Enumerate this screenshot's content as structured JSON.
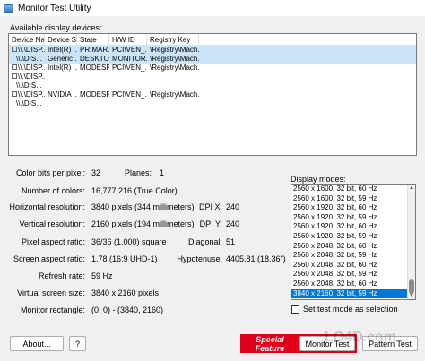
{
  "window": {
    "title": "Monitor Test Utility"
  },
  "devices": {
    "label": "Available display devices:",
    "columns": [
      "Device Na...",
      "Device S...",
      "State",
      "H/W ID",
      "Registry Key"
    ],
    "rows": [
      {
        "cells": [
          "\\\\.\\DISP...",
          "Intel(R) ...",
          "PRIMAR...",
          "PCI\\VEN_...",
          "\\Registry\\Mach..."
        ],
        "selected": true,
        "expander": true,
        "indent": false
      },
      {
        "cells": [
          "\\\\.\\DIS...",
          "Generic ...",
          "DESKTO...",
          "MONITOR...",
          "\\Registry\\Mach..."
        ],
        "selected": true,
        "expander": false,
        "indent": true
      },
      {
        "cells": [
          "\\\\.\\DISP...",
          "Intel(R) ...",
          "MODESP...",
          "PCI\\VEN_...",
          "\\Registry\\Mach..."
        ],
        "selected": false,
        "expander": true,
        "indent": false
      },
      {
        "cells": [
          "\\\\.\\DISP...",
          "",
          "",
          "",
          ""
        ],
        "selected": false,
        "expander": true,
        "indent": false
      },
      {
        "cells": [
          "\\\\.\\DIS...",
          "",
          "",
          "",
          ""
        ],
        "selected": false,
        "expander": false,
        "indent": true
      },
      {
        "cells": [
          "\\\\.\\DISP...",
          "NVIDIA ...",
          "MODESP...",
          "PCI\\VEN_...",
          "\\Registry\\Mach..."
        ],
        "selected": false,
        "expander": true,
        "indent": false
      },
      {
        "cells": [
          "\\\\.\\DIS...",
          "",
          "",
          "",
          ""
        ],
        "selected": false,
        "expander": false,
        "indent": true
      }
    ]
  },
  "info": {
    "color_bits_label": "Color bits per pixel:",
    "color_bits": "32",
    "planes_label": "Planes:",
    "planes": "1",
    "num_colors_label": "Number of colors:",
    "num_colors": "16,777,216 (True Color)",
    "hres_label": "Horizontal resolution:",
    "hres": "3840 pixels (344 millimeters)",
    "dpix_label": "DPI X:",
    "dpix": "240",
    "vres_label": "Vertical resolution:",
    "vres": "2160 pixels (194 millimeters)",
    "dpiy_label": "DPI Y:",
    "dpiy": "240",
    "pixel_aspect_label": "Pixel aspect ratio:",
    "pixel_aspect": "36/36 (1.000) square",
    "diagonal_label": "Diagonal:",
    "diagonal": "51",
    "screen_aspect_label": "Screen aspect ratio:",
    "screen_aspect": "1.78 (16:9 UHD-1)",
    "hypotenuse_label": "Hypotenuse:",
    "hypotenuse": "4405.81 (18.36\")",
    "refresh_label": "Refresh rate:",
    "refresh": "59 Hz",
    "virtual_label": "Virtual screen size:",
    "virtual": "3840 x 2160 pixels",
    "rect_label": "Monitor rectangle:",
    "rect": "(0, 0) - (3840, 2160)"
  },
  "modes": {
    "label": "Display modes:",
    "items": [
      "2560 x 1600, 32 bit, 60 Hz",
      "2560 x 1600, 32 bit, 59 Hz",
      "2560 x 1920, 32 bit, 60 Hz",
      "2560 x 1920, 32 bit, 59 Hz",
      "2560 x 1920, 32 bit, 60 Hz",
      "2560 x 1920, 32 bit, 59 Hz",
      "2560 x 2048, 32 bit, 60 Hz",
      "2560 x 2048, 32 bit, 59 Hz",
      "2560 x 2048, 32 bit, 60 Hz",
      "2560 x 2048, 32 bit, 59 Hz",
      "2560 x 2048, 32 bit, 60 Hz",
      "3840 x 2160, 32 bit, 59 Hz"
    ],
    "selected_index": 11,
    "checkbox_label": "Set test mode as selection"
  },
  "buttons": {
    "about": "About...",
    "help": "?",
    "special_feature": "Special Feature",
    "monitor_test": "Monitor Test",
    "pattern_test": "Pattern Test"
  },
  "watermark": "LO4D.com"
}
